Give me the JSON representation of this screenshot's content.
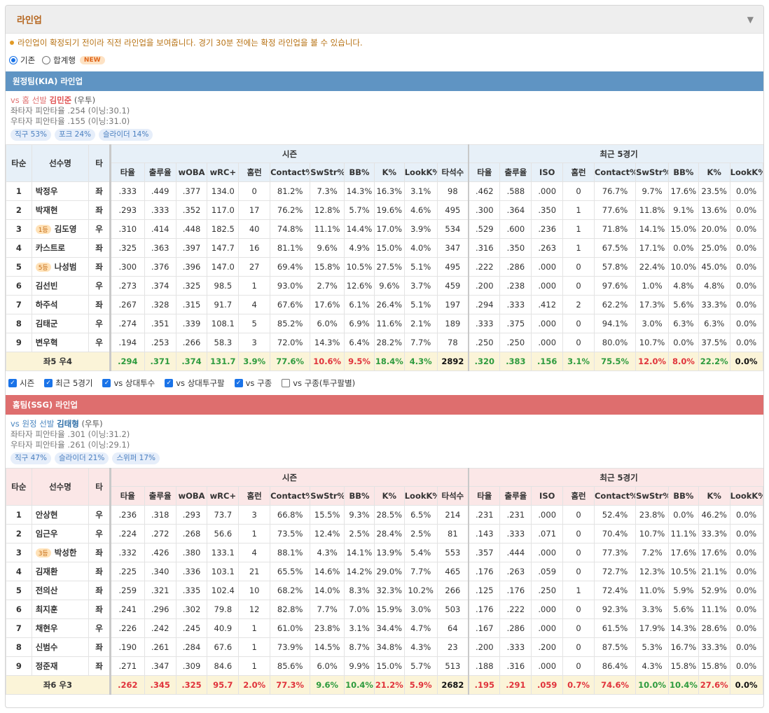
{
  "panel": {
    "title": "라인업",
    "collapse_icon": "▼"
  },
  "notice": "라인업이 확정되기 전이라 직전 라인업을 보여줍니다. 경기 30분 전에는 확정 라인업을 볼 수 있습니다.",
  "modes": {
    "option1": "기존",
    "option2": "합계행",
    "new_badge": "NEW",
    "selected": "기존"
  },
  "headers": {
    "order": "타순",
    "player": "선수명",
    "hand": "타",
    "season": "시즌",
    "recent": "최근 5경기",
    "season_cols": [
      "타율",
      "출루율",
      "wOBA",
      "wRC+",
      "홈런",
      "Contact%",
      "SwStr%",
      "BB%",
      "K%",
      "LookK%",
      "타석수"
    ],
    "recent_cols": [
      "타율",
      "출루율",
      "ISO",
      "홈런",
      "Contact%",
      "SwStr%",
      "BB%",
      "K%",
      "LookK%"
    ]
  },
  "away": {
    "team_title": "원정팀(KIA) 라인업",
    "vs_prefix": "vs 홈 선발",
    "pitcher_name": "김민준",
    "pitcher_hand": "(우투)",
    "split_left": "좌타자 피안타율 .254 (이닝:30.1)",
    "split_right": "우타자 피안타율 .155 (이닝:31.0)",
    "pitches": [
      "직구 53%",
      "포크 24%",
      "슬라이더 14%"
    ],
    "rows": [
      {
        "n": "1",
        "name": "박정우",
        "rank": "",
        "h": "좌",
        "s": [
          ".333",
          ".449",
          ".377",
          "134.0",
          "0",
          "81.2%",
          "7.3%",
          "14.3%",
          "16.3%",
          "3.1%",
          "98"
        ],
        "r": [
          ".462",
          ".588",
          ".000",
          "0",
          "76.7%",
          "9.7%",
          "17.6%",
          "23.5%",
          "0.0%"
        ]
      },
      {
        "n": "2",
        "name": "박재현",
        "rank": "",
        "h": "좌",
        "s": [
          ".293",
          ".333",
          ".352",
          "117.0",
          "17",
          "76.2%",
          "12.8%",
          "5.7%",
          "19.6%",
          "4.6%",
          "495"
        ],
        "r": [
          ".300",
          ".364",
          ".350",
          "1",
          "77.6%",
          "11.8%",
          "9.1%",
          "13.6%",
          "0.0%"
        ]
      },
      {
        "n": "3",
        "name": "김도영",
        "rank": "1등",
        "h": "우",
        "s": [
          ".310",
          ".414",
          ".448",
          "182.5",
          "40",
          "74.8%",
          "11.1%",
          "14.4%",
          "17.0%",
          "3.9%",
          "534"
        ],
        "r": [
          ".529",
          ".600",
          ".236",
          "1",
          "71.8%",
          "14.1%",
          "15.0%",
          "20.0%",
          "0.0%"
        ]
      },
      {
        "n": "4",
        "name": "카스트로",
        "rank": "",
        "h": "좌",
        "s": [
          ".325",
          ".363",
          ".397",
          "147.7",
          "16",
          "81.1%",
          "9.6%",
          "4.9%",
          "15.0%",
          "4.0%",
          "347"
        ],
        "r": [
          ".316",
          ".350",
          ".263",
          "1",
          "67.5%",
          "17.1%",
          "0.0%",
          "25.0%",
          "0.0%"
        ]
      },
      {
        "n": "5",
        "name": "나성범",
        "rank": "5등",
        "h": "좌",
        "s": [
          ".300",
          ".376",
          ".396",
          "147.0",
          "27",
          "69.4%",
          "15.8%",
          "10.5%",
          "27.5%",
          "5.1%",
          "495"
        ],
        "r": [
          ".222",
          ".286",
          ".000",
          "0",
          "57.8%",
          "22.4%",
          "10.0%",
          "45.0%",
          "0.0%"
        ]
      },
      {
        "n": "6",
        "name": "김선빈",
        "rank": "",
        "h": "우",
        "s": [
          ".273",
          ".374",
          ".325",
          "98.5",
          "1",
          "93.0%",
          "2.7%",
          "12.6%",
          "9.6%",
          "3.7%",
          "459"
        ],
        "r": [
          ".200",
          ".238",
          ".000",
          "0",
          "97.6%",
          "1.0%",
          "4.8%",
          "4.8%",
          "0.0%"
        ]
      },
      {
        "n": "7",
        "name": "하주석",
        "rank": "",
        "h": "좌",
        "s": [
          ".267",
          ".328",
          ".315",
          "91.7",
          "4",
          "67.6%",
          "17.6%",
          "6.1%",
          "26.4%",
          "5.1%",
          "197"
        ],
        "r": [
          ".294",
          ".333",
          ".412",
          "2",
          "62.2%",
          "17.3%",
          "5.6%",
          "33.3%",
          "0.0%"
        ]
      },
      {
        "n": "8",
        "name": "김태군",
        "rank": "",
        "h": "우",
        "s": [
          ".274",
          ".351",
          ".339",
          "108.1",
          "5",
          "85.2%",
          "6.0%",
          "6.9%",
          "11.6%",
          "2.1%",
          "189"
        ],
        "r": [
          ".333",
          ".375",
          ".000",
          "0",
          "94.1%",
          "3.0%",
          "6.3%",
          "6.3%",
          "0.0%"
        ]
      },
      {
        "n": "9",
        "name": "변우혁",
        "rank": "",
        "h": "우",
        "s": [
          ".194",
          ".253",
          ".266",
          "58.3",
          "3",
          "72.0%",
          "14.3%",
          "6.4%",
          "28.2%",
          "7.7%",
          "78"
        ],
        "r": [
          ".250",
          ".250",
          ".000",
          "0",
          "80.0%",
          "10.7%",
          "0.0%",
          "37.5%",
          "0.0%"
        ]
      }
    ],
    "summary": {
      "label": "좌5 우4",
      "s": [
        ".294",
        ".371",
        ".374",
        "131.7",
        "3.9%",
        "77.6%",
        "10.6%",
        "9.5%",
        "18.4%",
        "4.3%",
        "2892"
      ],
      "s_colors": [
        "g",
        "g",
        "g",
        "g",
        "g",
        "g",
        "r",
        "r",
        "g",
        "g",
        "k"
      ],
      "r": [
        ".320",
        ".383",
        ".156",
        "3.1%",
        "75.5%",
        "12.0%",
        "8.0%",
        "22.2%",
        "0.0%"
      ],
      "r_colors": [
        "g",
        "g",
        "g",
        "g",
        "g",
        "r",
        "r",
        "g",
        "k"
      ]
    }
  },
  "filters": [
    {
      "label": "시즌",
      "checked": true
    },
    {
      "label": "최근 5경기",
      "checked": true
    },
    {
      "label": "vs 상대투수",
      "checked": true
    },
    {
      "label": "vs 상대투구팔",
      "checked": true
    },
    {
      "label": "vs 구종",
      "checked": true
    },
    {
      "label": "vs 구종(투구팔별)",
      "checked": false
    }
  ],
  "home": {
    "team_title": "홈팀(SSG) 라인업",
    "vs_prefix": "vs 원정 선발",
    "pitcher_name": "김태형",
    "pitcher_hand": "(우투)",
    "split_left": "좌타자 피안타율 .301 (이닝:31.2)",
    "split_right": "우타자 피안타율 .261 (이닝:29.1)",
    "pitches": [
      "직구 47%",
      "슬라이더 21%",
      "스위퍼 17%"
    ],
    "rows": [
      {
        "n": "1",
        "name": "안상현",
        "rank": "",
        "h": "우",
        "s": [
          ".236",
          ".318",
          ".293",
          "73.7",
          "3",
          "66.8%",
          "15.5%",
          "9.3%",
          "28.5%",
          "6.5%",
          "214"
        ],
        "r": [
          ".231",
          ".231",
          ".000",
          "0",
          "52.4%",
          "23.8%",
          "0.0%",
          "46.2%",
          "0.0%"
        ]
      },
      {
        "n": "2",
        "name": "임근우",
        "rank": "",
        "h": "우",
        "s": [
          ".224",
          ".272",
          ".268",
          "56.6",
          "1",
          "73.5%",
          "12.4%",
          "2.5%",
          "28.4%",
          "2.5%",
          "81"
        ],
        "r": [
          ".143",
          ".333",
          ".071",
          "0",
          "70.4%",
          "10.7%",
          "11.1%",
          "33.3%",
          "0.0%"
        ]
      },
      {
        "n": "3",
        "name": "박성한",
        "rank": "3등",
        "h": "좌",
        "s": [
          ".332",
          ".426",
          ".380",
          "133.1",
          "4",
          "88.1%",
          "4.3%",
          "14.1%",
          "13.9%",
          "5.4%",
          "553"
        ],
        "r": [
          ".357",
          ".444",
          ".000",
          "0",
          "77.3%",
          "7.2%",
          "17.6%",
          "17.6%",
          "0.0%"
        ]
      },
      {
        "n": "4",
        "name": "김재환",
        "rank": "",
        "h": "좌",
        "s": [
          ".225",
          ".340",
          ".336",
          "103.1",
          "21",
          "65.5%",
          "14.6%",
          "14.2%",
          "29.0%",
          "7.7%",
          "465"
        ],
        "r": [
          ".176",
          ".263",
          ".059",
          "0",
          "72.7%",
          "12.3%",
          "10.5%",
          "21.1%",
          "0.0%"
        ]
      },
      {
        "n": "5",
        "name": "전의산",
        "rank": "",
        "h": "좌",
        "s": [
          ".259",
          ".321",
          ".335",
          "102.4",
          "10",
          "68.2%",
          "14.0%",
          "8.3%",
          "32.3%",
          "10.2%",
          "266"
        ],
        "r": [
          ".125",
          ".176",
          ".250",
          "1",
          "72.4%",
          "11.0%",
          "5.9%",
          "52.9%",
          "0.0%"
        ]
      },
      {
        "n": "6",
        "name": "최지훈",
        "rank": "",
        "h": "좌",
        "s": [
          ".241",
          ".296",
          ".302",
          "79.8",
          "12",
          "82.8%",
          "7.7%",
          "7.0%",
          "15.9%",
          "3.0%",
          "503"
        ],
        "r": [
          ".176",
          ".222",
          ".000",
          "0",
          "92.3%",
          "3.3%",
          "5.6%",
          "11.1%",
          "0.0%"
        ]
      },
      {
        "n": "7",
        "name": "채현우",
        "rank": "",
        "h": "우",
        "s": [
          ".226",
          ".242",
          ".245",
          "40.9",
          "1",
          "61.0%",
          "23.8%",
          "3.1%",
          "34.4%",
          "4.7%",
          "64"
        ],
        "r": [
          ".167",
          ".286",
          ".000",
          "0",
          "61.5%",
          "17.9%",
          "14.3%",
          "28.6%",
          "0.0%"
        ]
      },
      {
        "n": "8",
        "name": "신범수",
        "rank": "",
        "h": "좌",
        "s": [
          ".190",
          ".261",
          ".284",
          "67.6",
          "1",
          "73.9%",
          "14.5%",
          "8.7%",
          "34.8%",
          "4.3%",
          "23"
        ],
        "r": [
          ".200",
          ".333",
          ".200",
          "0",
          "87.5%",
          "5.3%",
          "16.7%",
          "33.3%",
          "0.0%"
        ]
      },
      {
        "n": "9",
        "name": "정준재",
        "rank": "",
        "h": "좌",
        "s": [
          ".271",
          ".347",
          ".309",
          "84.6",
          "1",
          "85.6%",
          "6.0%",
          "9.9%",
          "15.0%",
          "5.7%",
          "513"
        ],
        "r": [
          ".188",
          ".316",
          ".000",
          "0",
          "86.4%",
          "4.3%",
          "15.8%",
          "15.8%",
          "0.0%"
        ]
      }
    ],
    "summary": {
      "label": "좌6 우3",
      "s": [
        ".262",
        ".345",
        ".325",
        "95.7",
        "2.0%",
        "77.3%",
        "9.6%",
        "10.4%",
        "21.2%",
        "5.9%",
        "2682"
      ],
      "s_colors": [
        "r",
        "r",
        "r",
        "r",
        "r",
        "r",
        "g",
        "g",
        "r",
        "r",
        "k"
      ],
      "r": [
        ".195",
        ".291",
        ".059",
        "0.7%",
        "74.6%",
        "10.0%",
        "10.4%",
        "27.6%",
        "0.0%"
      ],
      "r_colors": [
        "r",
        "r",
        "r",
        "r",
        "r",
        "g",
        "g",
        "r",
        "k"
      ]
    }
  }
}
